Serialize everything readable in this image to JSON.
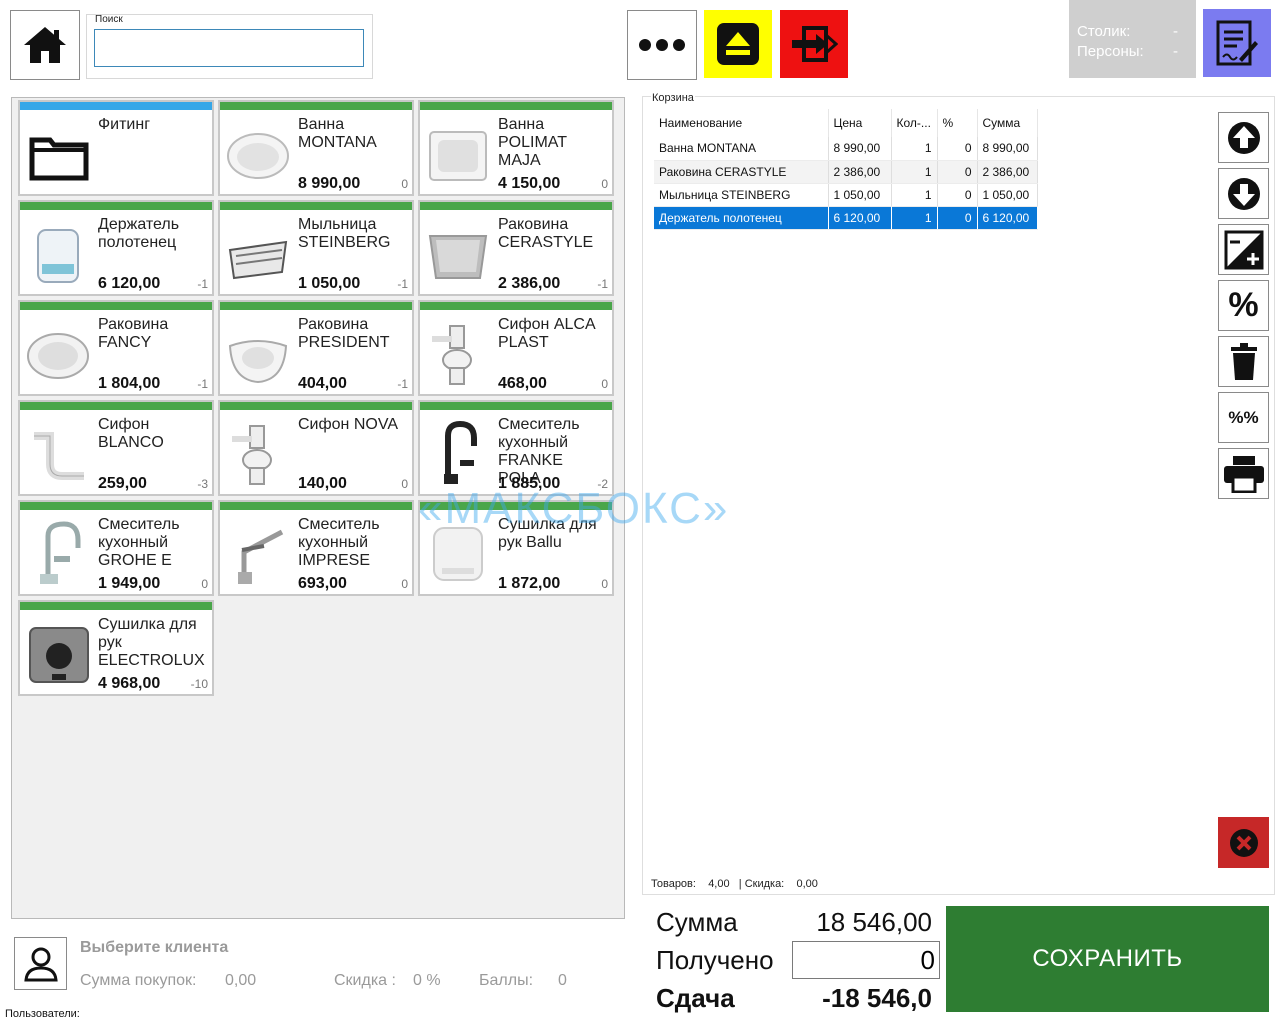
{
  "search": {
    "label": "Поиск",
    "value": ""
  },
  "table_info": {
    "table_label": "Столик:",
    "table_value": "-",
    "persons_label": "Персоны:",
    "persons_value": "-"
  },
  "products": [
    {
      "name": "Фитинг",
      "price": "",
      "stock": "",
      "bar": "blue",
      "icon": "folder-icon"
    },
    {
      "name": "Ванна MONTANA",
      "price": "8 990,00",
      "stock": "0",
      "bar": "green",
      "icon": "bathtub-icon"
    },
    {
      "name": "Ванна POLIMAT MAJA",
      "price": "4 150,00",
      "stock": "0",
      "bar": "green",
      "icon": "bathtub-square-icon"
    },
    {
      "name": "Держатель полотенец",
      "price": "6 120,00",
      "stock": "-1",
      "bar": "green",
      "icon": "towel-holder-icon"
    },
    {
      "name": "Мыльница STEINBERG",
      "price": "1 050,00",
      "stock": "-1",
      "bar": "green",
      "icon": "soap-dish-icon"
    },
    {
      "name": "Раковина CERASTYLE",
      "price": "2 386,00",
      "stock": "-1",
      "bar": "green",
      "icon": "sink-square-icon"
    },
    {
      "name": "Раковина FANCY",
      "price": "1 804,00",
      "stock": "-1",
      "bar": "green",
      "icon": "sink-oval-icon"
    },
    {
      "name": "Раковина PRESIDENT",
      "price": "404,00",
      "stock": "-1",
      "bar": "green",
      "icon": "sink-wall-icon"
    },
    {
      "name": "Сифон ALCA PLAST",
      "price": "468,00",
      "stock": "0",
      "bar": "green",
      "icon": "siphon-icon"
    },
    {
      "name": "Сифон BLANCO",
      "price": "259,00",
      "stock": "-3",
      "bar": "green",
      "icon": "siphon-pipe-icon"
    },
    {
      "name": "Сифон NOVA",
      "price": "140,00",
      "stock": "0",
      "bar": "green",
      "icon": "siphon-icon"
    },
    {
      "name": "Смеситель кухонный FRANKE POLA",
      "price": "1 885,00",
      "stock": "-2",
      "bar": "green",
      "icon": "faucet-black-icon"
    },
    {
      "name": "Смеситель кухонный GROHE E",
      "price": "1 949,00",
      "stock": "0",
      "bar": "green",
      "icon": "faucet-icon"
    },
    {
      "name": "Смеситель кухонный IMPRESE",
      "price": "693,00",
      "stock": "0",
      "bar": "green",
      "icon": "faucet-lever-icon"
    },
    {
      "name": "Сушилка для рук Ballu",
      "price": "1 872,00",
      "stock": "0",
      "bar": "green",
      "icon": "hand-dryer-white-icon"
    },
    {
      "name": "Сушилка для рук ELECTROLUX",
      "price": "4 968,00",
      "stock": "-10",
      "bar": "green",
      "icon": "hand-dryer-steel-icon"
    }
  ],
  "cart": {
    "label": "Корзина",
    "columns": [
      "Наименование",
      "Цена",
      "Кол-...",
      "%",
      "Сумма"
    ],
    "rows": [
      {
        "name": "Ванна MONTANA",
        "price": "8 990,00",
        "qty": "1",
        "disc": "0",
        "sum": "8 990,00"
      },
      {
        "name": "Раковина CERASTYLE",
        "price": "2 386,00",
        "qty": "1",
        "disc": "0",
        "sum": "2 386,00"
      },
      {
        "name": "Мыльница STEINBERG",
        "price": "1 050,00",
        "qty": "1",
        "disc": "0",
        "sum": "1 050,00"
      },
      {
        "name": "Держатель полотенец",
        "price": "6 120,00",
        "qty": "1",
        "disc": "0",
        "sum": "6 120,00"
      }
    ],
    "selected_row": 3,
    "footer": {
      "items_label": "Товаров:",
      "items_value": "4,00",
      "discount_label": "| Скидка:",
      "discount_value": "0,00"
    }
  },
  "side_buttons": {
    "percent_label": "%",
    "percent_percent_label": "%%"
  },
  "totals": {
    "sum_label": "Сумма",
    "sum_value": "18 546,00",
    "received_label": "Получено",
    "received_value": "0",
    "change_label": "Сдача",
    "change_value": "-18 546,0"
  },
  "save_label": "СОХРАНИТЬ",
  "client": {
    "title": "Выберите клиента",
    "purchases_label": "Сумма покупок:",
    "purchases_value": "0,00",
    "discount_label": "Скидка :",
    "discount_value": "0 %",
    "points_label": "Баллы:",
    "points_value": "0"
  },
  "users_label": "Пользователи:",
  "watermark": "«МАКСБОКС»",
  "colors": {
    "accent_green": "#4aa64a",
    "accent_blue": "#35a7e8",
    "save_green": "#2e7d32",
    "selection": "#0a78d7",
    "eject_yellow": "#ffff00",
    "exit_red": "#ee1111"
  }
}
